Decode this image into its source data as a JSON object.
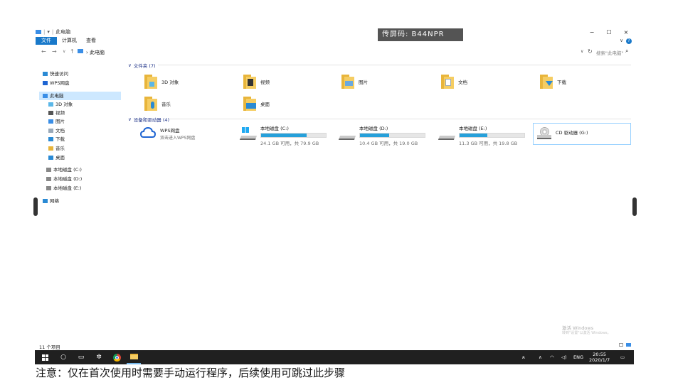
{
  "window": {
    "title": "此电脑",
    "tag_code": "传屏码: B44NPR",
    "minimize": "−",
    "maximize": "☐",
    "close": "×",
    "help": "?",
    "ribbon_expand": "∨"
  },
  "ribbon": {
    "tabs": [
      "文件",
      "计算机",
      "查看"
    ]
  },
  "address": {
    "back": "←",
    "forward": "→",
    "recent": "∨",
    "up": "↑",
    "path": "此电脑",
    "search_placeholder": "搜索\"此电脑\"",
    "refresh": "↻",
    "dropdown": "∨"
  },
  "nav_pane": {
    "items": [
      {
        "label": "快速访问",
        "icon": "star-icon"
      },
      {
        "label": "WPS网盘",
        "icon": "cloud-icon"
      },
      {
        "label": "此电脑",
        "icon": "computer-icon",
        "selected": true
      },
      {
        "label": "3D 对象",
        "icon": "3d-objects-icon"
      },
      {
        "label": "视频",
        "icon": "video-icon"
      },
      {
        "label": "图片",
        "icon": "pictures-icon"
      },
      {
        "label": "文档",
        "icon": "documents-icon"
      },
      {
        "label": "下载",
        "icon": "download-icon"
      },
      {
        "label": "音乐",
        "icon": "music-icon"
      },
      {
        "label": "桌面",
        "icon": "desktop-icon"
      },
      {
        "label": "本地磁盘 (C:)",
        "icon": "drive-icon"
      },
      {
        "label": "本地磁盘 (D:)",
        "icon": "drive-icon"
      },
      {
        "label": "本地磁盘 (E:)",
        "icon": "drive-icon"
      },
      {
        "label": "网络",
        "icon": "network-icon"
      }
    ]
  },
  "folders_group": {
    "header": "文件夹 (7)",
    "items": [
      {
        "label": "3D 对象",
        "icon": "3d-objects-folder-icon"
      },
      {
        "label": "视频",
        "icon": "video-folder-icon"
      },
      {
        "label": "图片",
        "icon": "pictures-folder-icon"
      },
      {
        "label": "文档",
        "icon": "documents-folder-icon"
      },
      {
        "label": "下载",
        "icon": "download-folder-icon"
      },
      {
        "label": "音乐",
        "icon": "music-folder-icon"
      },
      {
        "label": "桌面",
        "icon": "desktop-folder-icon"
      }
    ]
  },
  "devices_group": {
    "header": "设备和驱动器 (4)",
    "wps": {
      "title": "WPS网盘",
      "subtitle": "双击进入WPS网盘"
    },
    "drives": [
      {
        "name": "本地磁盘 (C:)",
        "space": "24.1 GB 可用，共 79.9 GB",
        "used_fraction": 0.7
      },
      {
        "name": "本地磁盘 (D:)",
        "space": "10.4 GB 可用，共 19.0 GB",
        "used_fraction": 0.45
      },
      {
        "name": "本地磁盘 (E:)",
        "space": "11.3 GB 可用，共 19.8 GB",
        "used_fraction": 0.43
      }
    ],
    "cd": {
      "name": "CD 驱动器 (G:)"
    }
  },
  "watermark": {
    "title": "激活 Windows",
    "subtitle": "转到\"设置\"以激活 Windows。"
  },
  "status_bar": {
    "count": "11 个项目"
  },
  "taskbar": {
    "tray_lang": "ENG",
    "time": "20:55",
    "date": "2020/1/7"
  },
  "caption": "注意：仅在首次使用时需要手动运行程序，后续使用可跳过此步骤"
}
